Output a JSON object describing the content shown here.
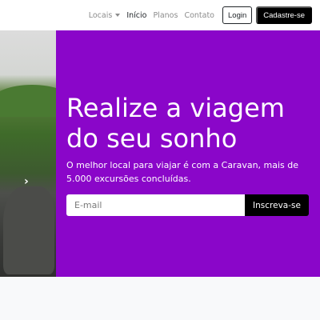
{
  "nav": {
    "links": [
      {
        "label": "Locais",
        "has_dropdown": true
      },
      {
        "label": "Início",
        "active": true
      },
      {
        "label": "Planos"
      },
      {
        "label": "Contato"
      }
    ],
    "login_label": "Login",
    "signup_label": "Cadastre-se"
  },
  "hero": {
    "title": "Realize a viagem do seu sonho",
    "subtitle": "O melhor local para viajar é com a Caravan, mais de 5.000 excursões concluídas.",
    "email_placeholder": "E-mail",
    "subscribe_label": "Inscreva-se",
    "carousel_arrow_icon": "chevron-right-icon"
  },
  "colors": {
    "accent": "#8a06c9",
    "button_dark": "#000000",
    "page_background": "#f8f9fa"
  }
}
